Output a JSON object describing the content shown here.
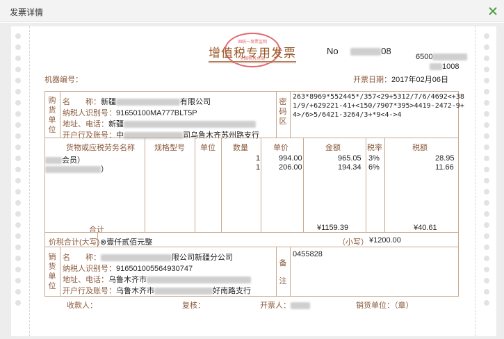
{
  "window": {
    "title": "发票详情"
  },
  "invoice": {
    "title": "增值税专用发票",
    "no_label": "No",
    "no_value": "08",
    "code_prefix": "6500",
    "code_suffix": "1008",
    "machine_label": "机器编号：",
    "date_label": "开票日期：",
    "date_value": "2017年02月06日"
  },
  "buyer": {
    "section_label": "购货单位",
    "name_label": "名　　称：",
    "name_prefix": "新疆",
    "name_suffix": "有限公司",
    "tax_label": "纳税人识别号：",
    "tax_id": "91650100MA777BLT5P",
    "addr_label": "地址、电话：",
    "addr_prefix": "新疆",
    "bank_label": "开户行及账号：",
    "bank_prefix": "中",
    "bank_suffix": "司乌鲁木齐苏州路支行"
  },
  "cipher": {
    "label": "密码区",
    "lines": [
      "263*8969*552445*/357<29+5312/7/6/4692<+38",
      "1/9/+629221-41+<150/7907*395>4419-2472-9+",
      "4>/6>5/6421-3264/3+*9<4->4"
    ]
  },
  "items_table": {
    "headers": [
      "货物或应税劳务名称",
      "规格型号",
      "单位",
      "数量",
      "单价",
      "金额",
      "税率",
      "税额"
    ],
    "rows": [
      {
        "name": "会员）",
        "spec": "",
        "unit": "",
        "qty": "1",
        "price": "994.00",
        "amount": "965.05",
        "rate": "3%",
        "tax": "28.95"
      },
      {
        "name": "）",
        "spec": "",
        "unit": "",
        "qty": "1",
        "price": "206.00",
        "amount": "194.34",
        "rate": "6%",
        "tax": "11.66"
      }
    ],
    "total_label": "合计",
    "total_amount": "¥1159.39",
    "total_tax": "¥40.61"
  },
  "grand_total": {
    "label": "价税合计(大写)",
    "words": "⊗壹仟贰佰元整",
    "small_label": "（小写）",
    "small_value": "¥1200.00"
  },
  "seller": {
    "section_label": "销货单位",
    "name_label": "名　　称：",
    "name_suffix": "限公司新疆分公司",
    "tax_label": "纳税人识别号：",
    "tax_id": "916501005564930747",
    "addr_label": "地址、电话：",
    "addr_prefix": "乌鲁木齐市",
    "bank_label": "开户行及账号：",
    "bank_prefix": "乌鲁木齐市",
    "bank_suffix": "好南路支行",
    "remark_label": "备注",
    "remark_value": "0455828"
  },
  "footer": {
    "payee_label": "收款人：",
    "reviewer_label": "复核：",
    "drawer_label": "开票人：",
    "seller_label": "销货单位：（章）"
  },
  "seal": {
    "top_text": "国统一发票监制",
    "bottom_text": "全国税务总局"
  }
}
